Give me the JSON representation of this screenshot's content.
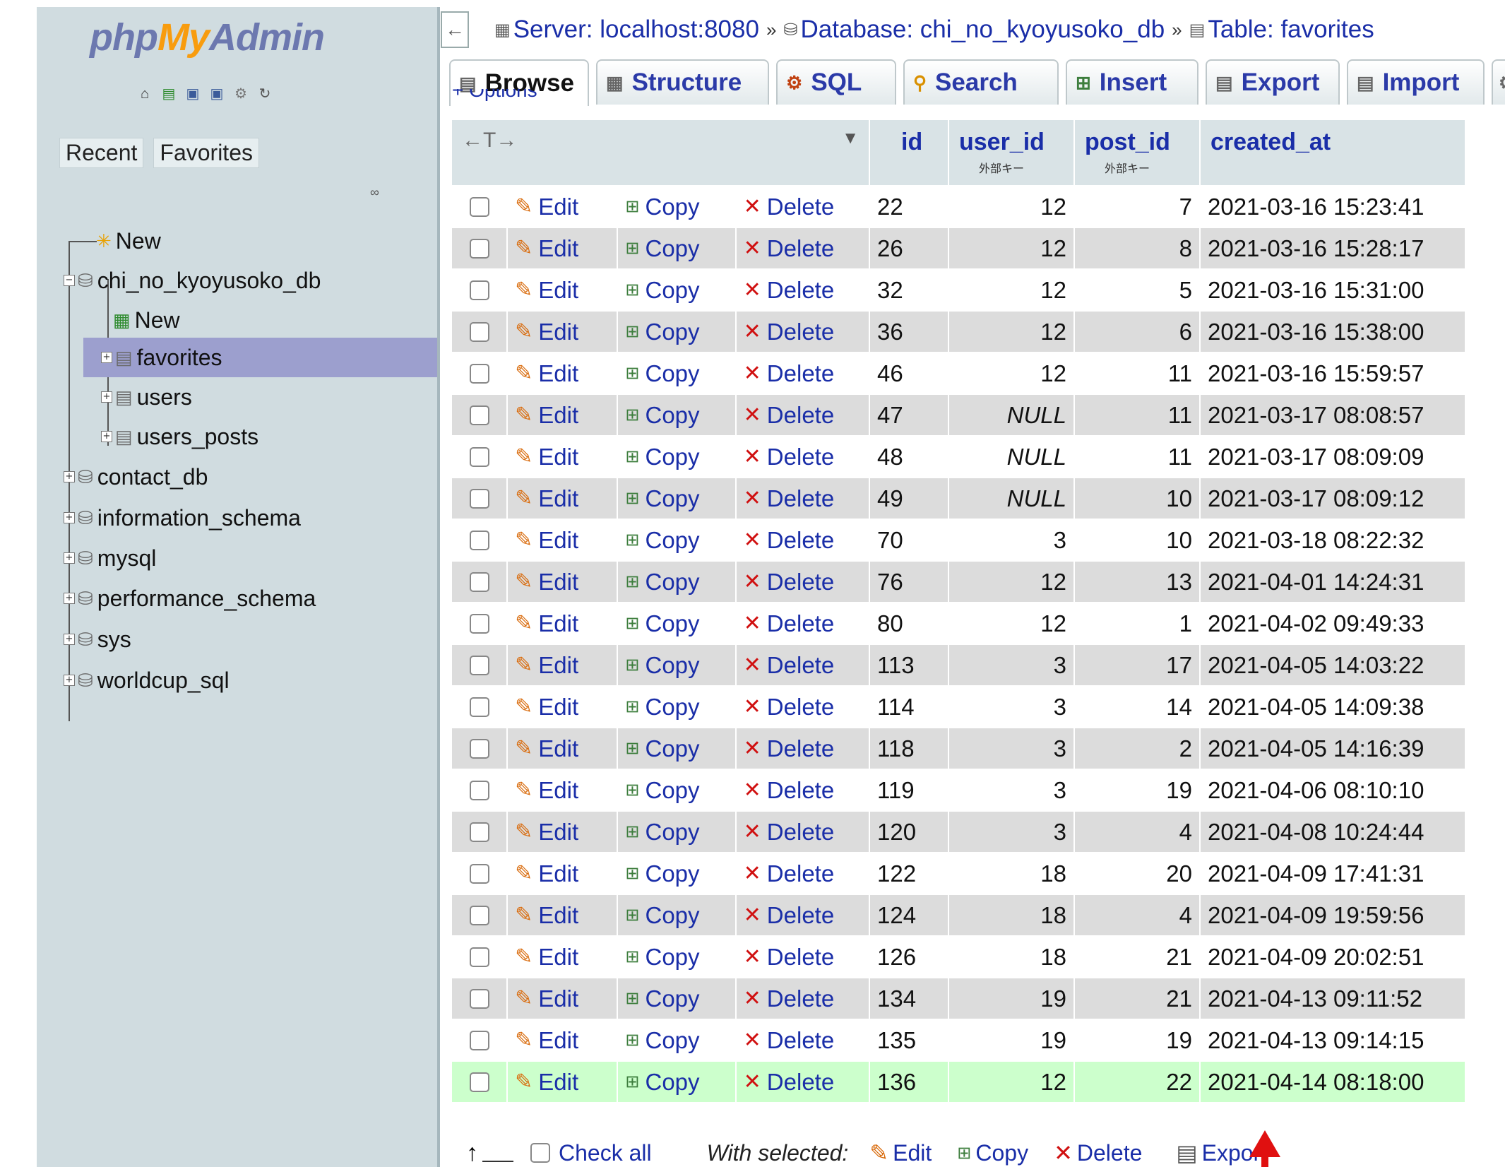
{
  "logo": {
    "php": "php",
    "my": "My",
    "admin": "Admin"
  },
  "nav_icons": [
    "home-icon",
    "exit-icon",
    "docs-icon",
    "sql-docs-icon",
    "settings-icon",
    "reload-icon"
  ],
  "sidebar_tabs": {
    "recent": "Recent",
    "favorites": "Favorites"
  },
  "tree": {
    "new": "New",
    "db_main": "chi_no_kyoyusoko_db",
    "db_main_new": "New",
    "tables": [
      "favorites",
      "users",
      "users_posts"
    ],
    "dbs": [
      "contact_db",
      "information_schema",
      "mysql",
      "performance_schema",
      "sys",
      "worldcup_sql"
    ]
  },
  "breadcrumb": {
    "server": "Server: localhost:8080",
    "database": "Database: chi_no_kyoyusoko_db",
    "table": "Table: favorites",
    "separator": "»"
  },
  "tabs": [
    "Browse",
    "Structure",
    "SQL",
    "Search",
    "Insert",
    "Export",
    "Import"
  ],
  "options_label": "+ Options",
  "table": {
    "arrows_label": "←T→",
    "columns": {
      "id": "id",
      "user_id": "user_id",
      "post_id": "post_id",
      "created_at": "created_at",
      "fk_note": "外部キー"
    },
    "actions": {
      "edit": "Edit",
      "copy": "Copy",
      "delete": "Delete"
    },
    "rows": [
      {
        "id": "22",
        "user_id": "12",
        "post_id": "7",
        "created_at": "2021-03-16 15:23:41"
      },
      {
        "id": "26",
        "user_id": "12",
        "post_id": "8",
        "created_at": "2021-03-16 15:28:17"
      },
      {
        "id": "32",
        "user_id": "12",
        "post_id": "5",
        "created_at": "2021-03-16 15:31:00"
      },
      {
        "id": "36",
        "user_id": "12",
        "post_id": "6",
        "created_at": "2021-03-16 15:38:00"
      },
      {
        "id": "46",
        "user_id": "12",
        "post_id": "11",
        "created_at": "2021-03-16 15:59:57"
      },
      {
        "id": "47",
        "user_id": "NULL",
        "post_id": "11",
        "created_at": "2021-03-17 08:08:57"
      },
      {
        "id": "48",
        "user_id": "NULL",
        "post_id": "11",
        "created_at": "2021-03-17 08:09:09"
      },
      {
        "id": "49",
        "user_id": "NULL",
        "post_id": "10",
        "created_at": "2021-03-17 08:09:12"
      },
      {
        "id": "70",
        "user_id": "3",
        "post_id": "10",
        "created_at": "2021-03-18 08:22:32"
      },
      {
        "id": "76",
        "user_id": "12",
        "post_id": "13",
        "created_at": "2021-04-01 14:24:31"
      },
      {
        "id": "80",
        "user_id": "12",
        "post_id": "1",
        "created_at": "2021-04-02 09:49:33"
      },
      {
        "id": "113",
        "user_id": "3",
        "post_id": "17",
        "created_at": "2021-04-05 14:03:22"
      },
      {
        "id": "114",
        "user_id": "3",
        "post_id": "14",
        "created_at": "2021-04-05 14:09:38"
      },
      {
        "id": "118",
        "user_id": "3",
        "post_id": "2",
        "created_at": "2021-04-05 14:16:39"
      },
      {
        "id": "119",
        "user_id": "3",
        "post_id": "19",
        "created_at": "2021-04-06 08:10:10"
      },
      {
        "id": "120",
        "user_id": "3",
        "post_id": "4",
        "created_at": "2021-04-08 10:24:44"
      },
      {
        "id": "122",
        "user_id": "18",
        "post_id": "20",
        "created_at": "2021-04-09 17:41:31"
      },
      {
        "id": "124",
        "user_id": "18",
        "post_id": "4",
        "created_at": "2021-04-09 19:59:56"
      },
      {
        "id": "126",
        "user_id": "18",
        "post_id": "21",
        "created_at": "2021-04-09 20:02:51"
      },
      {
        "id": "134",
        "user_id": "19",
        "post_id": "21",
        "created_at": "2021-04-13 09:11:52"
      },
      {
        "id": "135",
        "user_id": "19",
        "post_id": "19",
        "created_at": "2021-04-13 09:14:15"
      },
      {
        "id": "136",
        "user_id": "12",
        "post_id": "22",
        "created_at": "2021-04-14 08:18:00"
      }
    ],
    "highlight_row_index": 21
  },
  "footer": {
    "check_all": "Check all",
    "with_selected": "With selected:",
    "edit": "Edit",
    "copy": "Copy",
    "delete": "Delete",
    "export": "Export"
  },
  "colors": {
    "link": "#1a2ea8",
    "sidebar_bg": "#d0dce0",
    "selected_tree": "#9c9fce",
    "highlight_row": "#ccffcc",
    "annotation_arrow": "#e01010"
  }
}
